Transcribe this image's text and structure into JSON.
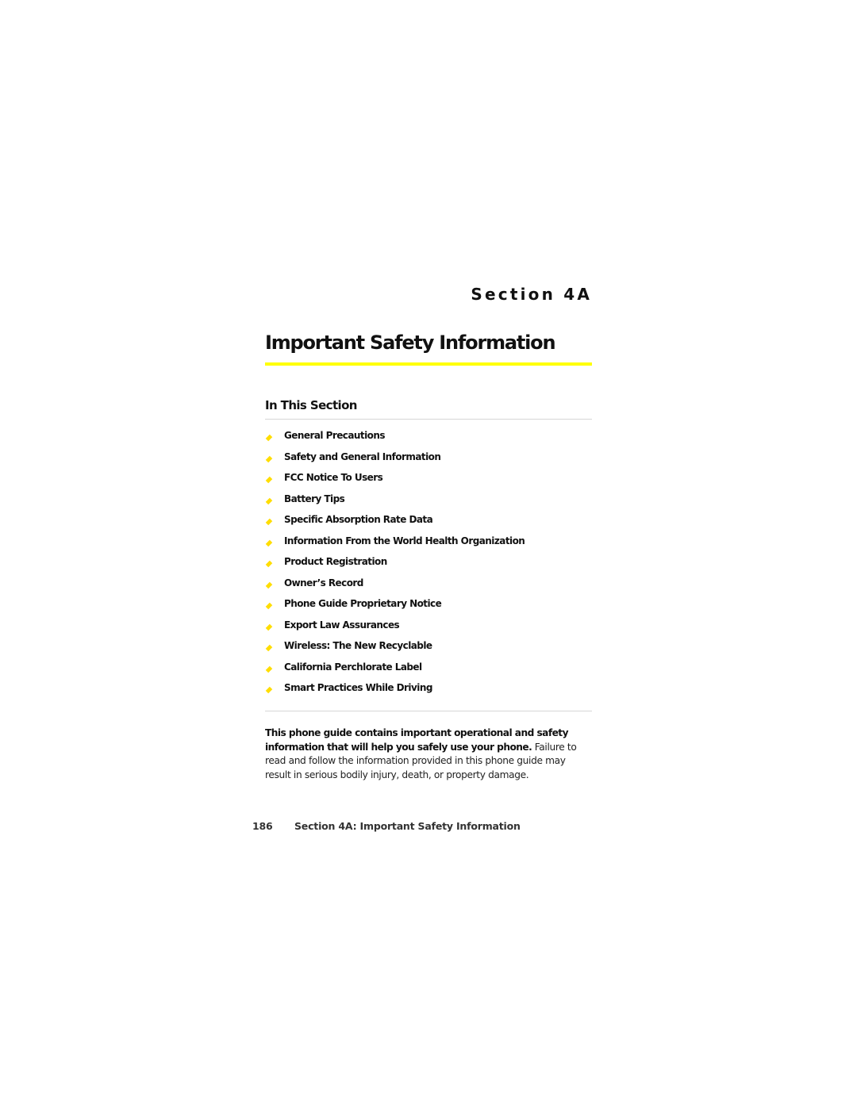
{
  "section": {
    "label": "Section 4A",
    "title": "Important Safety Information"
  },
  "in_this_section": {
    "heading": "In This Section",
    "items": [
      {
        "label": "General Precautions"
      },
      {
        "label": "Safety and General Information"
      },
      {
        "label": "FCC Notice To Users"
      },
      {
        "label": "Battery Tips"
      },
      {
        "label": "Specific Absorption Rate Data"
      },
      {
        "label": "Information From the World Health Organization"
      },
      {
        "label": "Product Registration"
      },
      {
        "label": "Owner’s Record"
      },
      {
        "label": "Phone Guide Proprietary Notice"
      },
      {
        "label": "Export Law Assurances"
      },
      {
        "label": "Wireless: The New Recyclable"
      },
      {
        "label": "California Perchlorate Label"
      },
      {
        "label": "Smart Practices While Driving"
      }
    ],
    "bullet_icon": "diamond-bullet",
    "bullet_color": "#FFDD00"
  },
  "intro": {
    "bold_text": "This phone guide contains important operational and safety information that will help you safely use your phone.",
    "regular_text": " Failure to read and follow the information provided in this phone guide may result in serious bodily injury, death, or property damage."
  },
  "footer": {
    "page_number": "186",
    "running_title": "Section 4A: Important Safety Information"
  },
  "colors": {
    "accent_rule": "#FFFF00",
    "text": "#111111",
    "divider": "#D6D6D6"
  }
}
